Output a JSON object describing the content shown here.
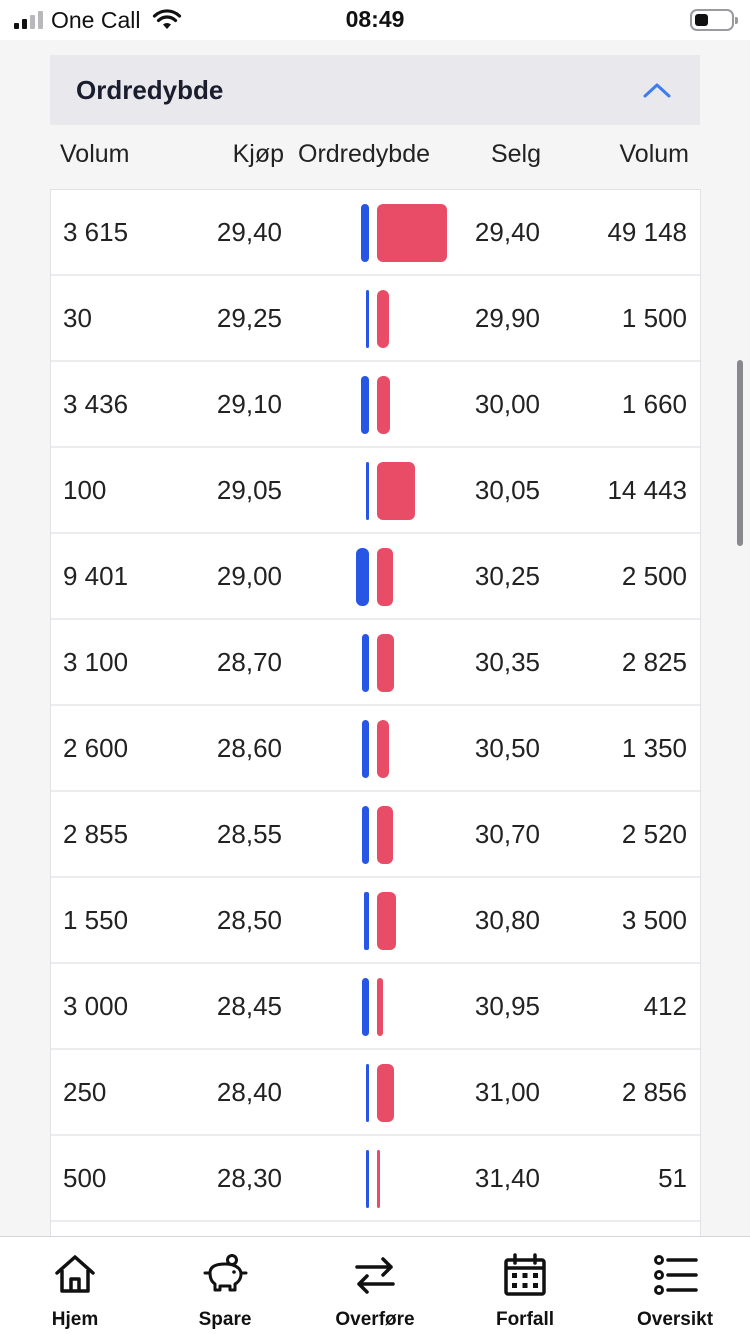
{
  "status_bar": {
    "carrier": "One Call",
    "time": "08:49",
    "signal_bars": 4,
    "signal_bars_active": 2,
    "battery_level": 0.3
  },
  "panel": {
    "title": "Ordredybde",
    "toggle_icon": "chevron-up-icon",
    "accent_color": "#3d7cf0"
  },
  "columns": {
    "buy_volume": "Volum",
    "bid": "Kjøp",
    "depth": "Ordredybde",
    "ask": "Selg",
    "sell_volume": "Volum"
  },
  "colors": {
    "buy": "#2856e4",
    "sell": "#e84c67"
  },
  "rows": [
    {
      "buy_volume": "3 615",
      "bid": "29,40",
      "ask": "29,40",
      "sell_volume": "49 148",
      "buy_depth": 3615,
      "sell_depth": 49148
    },
    {
      "buy_volume": "30",
      "bid": "29,25",
      "ask": "29,90",
      "sell_volume": "1 500",
      "buy_depth": 30,
      "sell_depth": 1500
    },
    {
      "buy_volume": "3 436",
      "bid": "29,10",
      "ask": "30,00",
      "sell_volume": "1 660",
      "buy_depth": 3436,
      "sell_depth": 1660
    },
    {
      "buy_volume": "100",
      "bid": "29,05",
      "ask": "30,05",
      "sell_volume": "14 443",
      "buy_depth": 100,
      "sell_depth": 14443
    },
    {
      "buy_volume": "9 401",
      "bid": "29,00",
      "ask": "30,25",
      "sell_volume": "2 500",
      "buy_depth": 9401,
      "sell_depth": 2500
    },
    {
      "buy_volume": "3 100",
      "bid": "28,70",
      "ask": "30,35",
      "sell_volume": "2 825",
      "buy_depth": 3100,
      "sell_depth": 2825
    },
    {
      "buy_volume": "2 600",
      "bid": "28,60",
      "ask": "30,50",
      "sell_volume": "1 350",
      "buy_depth": 2600,
      "sell_depth": 1350
    },
    {
      "buy_volume": "2 855",
      "bid": "28,55",
      "ask": "30,70",
      "sell_volume": "2 520",
      "buy_depth": 2855,
      "sell_depth": 2520
    },
    {
      "buy_volume": "1 550",
      "bid": "28,50",
      "ask": "30,80",
      "sell_volume": "3 500",
      "buy_depth": 1550,
      "sell_depth": 3500
    },
    {
      "buy_volume": "3 000",
      "bid": "28,45",
      "ask": "30,95",
      "sell_volume": "412",
      "buy_depth": 3000,
      "sell_depth": 412
    },
    {
      "buy_volume": "250",
      "bid": "28,40",
      "ask": "31,00",
      "sell_volume": "2 856",
      "buy_depth": 250,
      "sell_depth": 2856
    },
    {
      "buy_volume": "500",
      "bid": "28,30",
      "ask": "31,40",
      "sell_volume": "51",
      "buy_depth": 500,
      "sell_depth": 51
    },
    {
      "buy_volume": "",
      "bid": "",
      "ask": "",
      "sell_volume": "",
      "buy_depth": 0,
      "sell_depth": 0
    }
  ],
  "tabs": [
    {
      "label": "Hjem",
      "icon": "home-icon"
    },
    {
      "label": "Spare",
      "icon": "piggy-bank-icon"
    },
    {
      "label": "Overføre",
      "icon": "transfer-arrows-icon"
    },
    {
      "label": "Forfall",
      "icon": "calendar-icon"
    },
    {
      "label": "Oversikt",
      "icon": "list-icon"
    }
  ]
}
